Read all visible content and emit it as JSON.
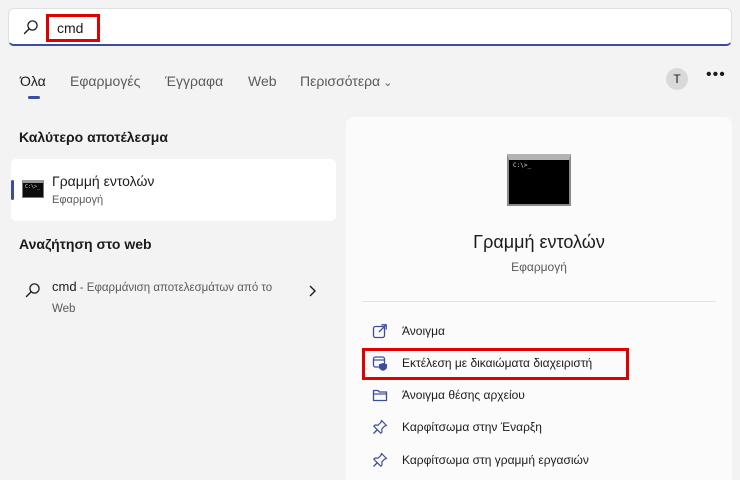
{
  "search": {
    "value": "cmd"
  },
  "tabs": [
    {
      "label": "Όλα",
      "active": true
    },
    {
      "label": "Εφαρμογές"
    },
    {
      "label": "Έγγραφα"
    },
    {
      "label": "Web"
    },
    {
      "label": "Περισσότερα"
    }
  ],
  "user": {
    "initial": "T"
  },
  "left": {
    "best_match_title": "Καλύτερο αποτέλεσμα",
    "best_match": {
      "name": "Γραμμή εντολών",
      "type": "Εφαρμογή",
      "icon_text": "C:\\>_"
    },
    "web_title": "Αναζήτηση στο web",
    "web_item": {
      "query": "cmd",
      "suffix": " - Εφαρμάνιση αποτελεσμάτων από το Web"
    }
  },
  "detail": {
    "icon_text": "C:\\>_",
    "title": "Γραμμή εντολών",
    "subtitle": "Εφαρμογή",
    "actions": [
      {
        "label": "Άνοιγμα",
        "icon": "open-external-icon"
      },
      {
        "label": "Εκτέλεση με δικαιώματα διαχειριστή",
        "icon": "shield-admin-icon"
      },
      {
        "label": "Άνοιγμα θέσης αρχείου",
        "icon": "folder-icon"
      },
      {
        "label": "Καρφίτσωμα στην Έναρξη",
        "icon": "pin-icon"
      },
      {
        "label": "Καρφίτσωμα στη γραμμή εργασιών",
        "icon": "pin-icon"
      }
    ]
  },
  "colors": {
    "accent": "#3c4d9e",
    "highlight": "#e00000"
  }
}
